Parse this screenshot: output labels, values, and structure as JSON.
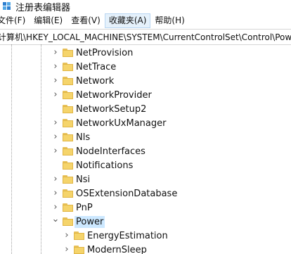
{
  "window": {
    "title": "注册表编辑器"
  },
  "menu": [
    {
      "label": "文件(F)"
    },
    {
      "label": "编辑(E)"
    },
    {
      "label": "查看(V)"
    },
    {
      "label": "收藏夹(A)"
    },
    {
      "label": "帮助(H)"
    }
  ],
  "address": {
    "path": "计算机\\HKEY_LOCAL_MACHINE\\SYSTEM\\CurrentControlSet\\Control\\Power"
  },
  "tree": {
    "items": [
      {
        "label": "NetProvision",
        "expander": "collapsed"
      },
      {
        "label": "NetTrace",
        "expander": "collapsed"
      },
      {
        "label": "Network",
        "expander": "collapsed"
      },
      {
        "label": "NetworkProvider",
        "expander": "collapsed"
      },
      {
        "label": "NetworkSetup2",
        "expander": "none"
      },
      {
        "label": "NetworkUxManager",
        "expander": "collapsed"
      },
      {
        "label": "Nls",
        "expander": "collapsed"
      },
      {
        "label": "NodeInterfaces",
        "expander": "collapsed"
      },
      {
        "label": "Notifications",
        "expander": "none"
      },
      {
        "label": "Nsi",
        "expander": "collapsed"
      },
      {
        "label": "OSExtensionDatabase",
        "expander": "collapsed"
      },
      {
        "label": "PnP",
        "expander": "collapsed"
      },
      {
        "label": "Power",
        "expander": "expanded",
        "selected": true
      },
      {
        "label": "EnergyEstimation",
        "expander": "collapsed",
        "child": true
      },
      {
        "label": "ModernSleep",
        "expander": "collapsed",
        "child": true
      }
    ]
  },
  "icons": {
    "expand": "chevron-right-icon",
    "collapse": "chevron-down-icon",
    "folder": "folder-icon"
  },
  "colors": {
    "folder": "#f5d46b",
    "selection": "#cce8ff",
    "menu_active": "#e5f1fb"
  }
}
